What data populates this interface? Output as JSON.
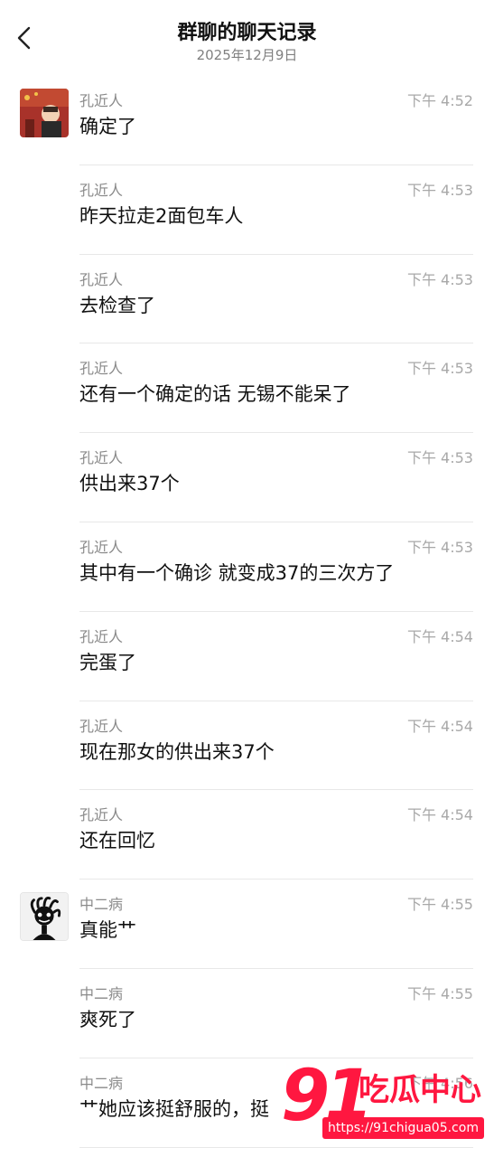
{
  "header": {
    "title": "群聊的聊天记录",
    "date": "2025年12月9日"
  },
  "messages": [
    {
      "sender": "孔近人",
      "time": "下午 4:52",
      "text": "确定了",
      "avatar": "user-avatar-photo"
    },
    {
      "sender": "孔近人",
      "time": "下午 4:53",
      "text": "昨天拉走2面包车人"
    },
    {
      "sender": "孔近人",
      "time": "下午 4:53",
      "text": "去检查了"
    },
    {
      "sender": "孔近人",
      "time": "下午 4:53",
      "text": "还有一个确定的话 无锡不能呆了"
    },
    {
      "sender": "孔近人",
      "time": "下午 4:53",
      "text": "供出来37个"
    },
    {
      "sender": "孔近人",
      "time": "下午 4:53",
      "text": "其中有一个确诊 就变成37的三次方了"
    },
    {
      "sender": "孔近人",
      "time": "下午 4:54",
      "text": "完蛋了"
    },
    {
      "sender": "孔近人",
      "time": "下午 4:54",
      "text": "现在那女的供出来37个"
    },
    {
      "sender": "孔近人",
      "time": "下午 4:54",
      "text": "还在回忆"
    },
    {
      "sender": "中二病",
      "time": "下午 4:55",
      "text": "真能艹",
      "avatar": "cartoon-avatar"
    },
    {
      "sender": "中二病",
      "time": "下午 4:55",
      "text": "爽死了"
    },
    {
      "sender": "中二病",
      "time": "下午 4:56",
      "text": "艹她应该挺舒服的，挺"
    }
  ],
  "watermark": {
    "number": "91",
    "brand": "吃瓜中心",
    "url": "https://91chigua05.com"
  }
}
